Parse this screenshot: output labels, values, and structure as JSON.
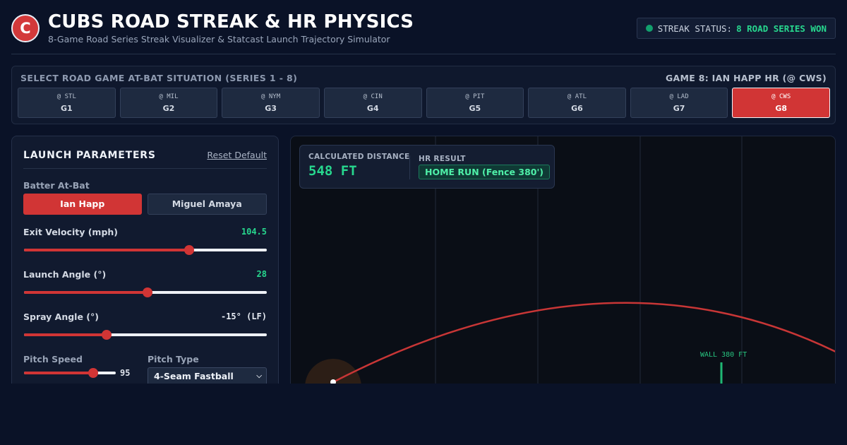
{
  "header": {
    "logo_letter": "C",
    "title": "CUBS ROAD STREAK & HR PHYSICS",
    "subtitle": "8-Game Road Series Streak Visualizer & Statcast Launch Trajectory Simulator",
    "status_label": "STREAK STATUS:",
    "status_value": "8 ROAD SERIES WON",
    "status_dot_color": "#12a06d"
  },
  "games": {
    "select_label": "SELECT ROAD GAME AT-BAT SITUATION (SERIES 1 - 8)",
    "current_label": "GAME 8: IAN HAPP HR (@ CWS)",
    "items": [
      {
        "opp": "@ STL",
        "game": "G1",
        "active": false
      },
      {
        "opp": "@ MIL",
        "game": "G2",
        "active": false
      },
      {
        "opp": "@ NYM",
        "game": "G3",
        "active": false
      },
      {
        "opp": "@ CIN",
        "game": "G4",
        "active": false
      },
      {
        "opp": "@ PIT",
        "game": "G5",
        "active": false
      },
      {
        "opp": "@ ATL",
        "game": "G6",
        "active": false
      },
      {
        "opp": "@ LAD",
        "game": "G7",
        "active": false
      },
      {
        "opp": "@ CWS",
        "game": "G8",
        "active": true
      }
    ]
  },
  "params": {
    "title": "LAUNCH PARAMETERS",
    "reset_label": "Reset Default",
    "batter_label": "Batter At-Bat",
    "batters": [
      {
        "name": "Ian Happ",
        "active": true
      },
      {
        "name": "Miguel Amaya",
        "active": false
      }
    ],
    "exit_velocity": {
      "label": "Exit Velocity (mph)",
      "value": "104.5",
      "fraction": 0.68
    },
    "launch_angle": {
      "label": "Launch Angle (°)",
      "value": "28",
      "fraction": 0.51
    },
    "spray_angle": {
      "label": "Spray Angle (°)",
      "value": "-15° (LF)",
      "fraction": 0.34
    },
    "pitch_speed": {
      "label": "Pitch Speed",
      "value": "95",
      "fraction": 0.75
    },
    "pitch_type": {
      "label": "Pitch Type",
      "value": "4-Seam Fastball"
    }
  },
  "result": {
    "distance_label": "CALCULATED DISTANCE",
    "distance_value": "548 FT",
    "hr_label": "HR RESULT",
    "hr_value": "HOME RUN (Fence 380')",
    "wall_label": "WALL 380 FT"
  },
  "colors": {
    "accent_red": "#d13535",
    "accent_green": "#27d78e"
  }
}
